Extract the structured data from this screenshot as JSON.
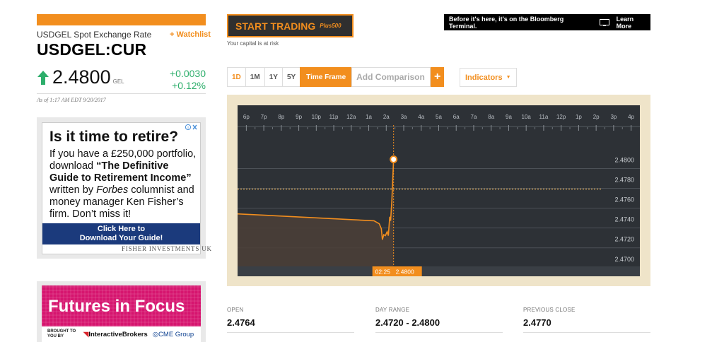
{
  "quote": {
    "subtitle": "USDGEL Spot Exchange Rate",
    "watchlist_label": "+ Watchlist",
    "ticker": "USDGEL:CUR",
    "price": "2.4800",
    "currency": "GEL",
    "change_abs": "+0.0030",
    "change_pct": "+0.12%",
    "as_of": "As of 1:17 AM EDT 9/20/2017",
    "direction_icon": "up-arrow-icon",
    "colors": {
      "up": "#2dae6b",
      "accent": "#f28e1e"
    }
  },
  "ad_fisher": {
    "headline": "Is it time to retire?",
    "body_1": "If you have a £250,000 portfolio, download ",
    "body_bold": "“The Definitive Guide to Retirement Income”",
    "body_2": " written by ",
    "body_italic": "Forbes",
    "body_3": " columnist and money manager Ken Fisher’s firm. Don’t miss it!",
    "cta_line1": "Click Here to",
    "cta_line2": "Download Your Guide!",
    "brand": "FISHER INVESTMENTS UK",
    "close_icon": "ad-choices-icon"
  },
  "ad_futures": {
    "title": "Futures in Focus",
    "brought_by": "BROUGHT TO YOU BY",
    "sponsor1": "InteractiveBrokers",
    "sponsor2": "CME Group"
  },
  "promo": {
    "start_label": "START TRADING",
    "partner": "Plus500",
    "risk_note": "Your capital is at risk"
  },
  "bloomberg_banner": {
    "text": "Before it's here, it's on the Bloomberg Terminal.",
    "learn_more": "Learn More"
  },
  "toolbar": {
    "ranges": [
      "1D",
      "1M",
      "1Y",
      "5Y"
    ],
    "timeframe_label": "Time Frame",
    "compare_placeholder": "Add Comparison",
    "add_label": "+",
    "indicators_label": "Indicators",
    "indicators_caret": "▼"
  },
  "chart_data": {
    "type": "line",
    "x_ticks": [
      "6p",
      "7p",
      "8p",
      "9p",
      "10p",
      "11p",
      "12a",
      "1a",
      "2a",
      "3a",
      "4a",
      "5a",
      "6a",
      "7a",
      "8a",
      "9a",
      "10a",
      "11a",
      "12p",
      "1p",
      "2p",
      "3p",
      "4p"
    ],
    "y_ticks": [
      "2.4800",
      "2.4780",
      "2.4760",
      "2.4740",
      "2.4720",
      "2.4700"
    ],
    "ylim": [
      2.4692,
      2.4826
    ],
    "x_range_hours": [
      -0.5,
      22.5
    ],
    "series": [
      {
        "x": [
          -0.5,
          7.3,
          7.6,
          7.72,
          7.78,
          7.86,
          7.95,
          8.05,
          8.12,
          8.2,
          8.25,
          8.32,
          8.42
        ],
        "values": [
          2.4745,
          2.4738,
          2.4735,
          2.473,
          2.4719,
          2.4724,
          2.4723,
          2.4727,
          2.4723,
          2.4742,
          2.4738,
          2.4758,
          2.48
        ]
      }
    ],
    "previous_close": 2.477,
    "crosshair": {
      "time": "02:25",
      "value": "2.4800",
      "x": 8.42
    },
    "colors": {
      "line": "#f28e1e",
      "plot_bg": "#2d3136",
      "area": "#4a3f37",
      "frame": "#efe4c9"
    },
    "grid": true
  },
  "stats": [
    {
      "label": "OPEN",
      "value": "2.4764"
    },
    {
      "label": "DAY RANGE",
      "value": "2.4720 - 2.4800"
    },
    {
      "label": "PREVIOUS CLOSE",
      "value": "2.4770"
    }
  ]
}
